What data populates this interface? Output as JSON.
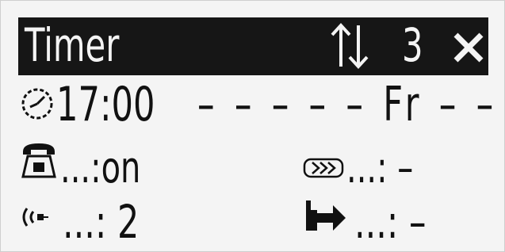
{
  "header": {
    "title": "Timer",
    "arrows_icon": "up-down-arrows-icon",
    "number": "3",
    "close_icon": "close-icon"
  },
  "timer_row": {
    "icon": "clock-icon",
    "time": "17:00",
    "days": "– – – – – Fr – –"
  },
  "phone_row": {
    "icon": "telephone-icon",
    "value": "...:on"
  },
  "answering_row": {
    "icon": "answering-machine-icon",
    "value": "...: –"
  },
  "ring_row": {
    "icon": "ringer-icon",
    "value": "...: 2"
  },
  "forward_row": {
    "icon": "call-forward-icon",
    "value": "...: –"
  },
  "colors": {
    "background": "#f4f4f4",
    "foreground": "#111111",
    "header_bg": "#161616",
    "header_fg": "#f4f4f4"
  }
}
